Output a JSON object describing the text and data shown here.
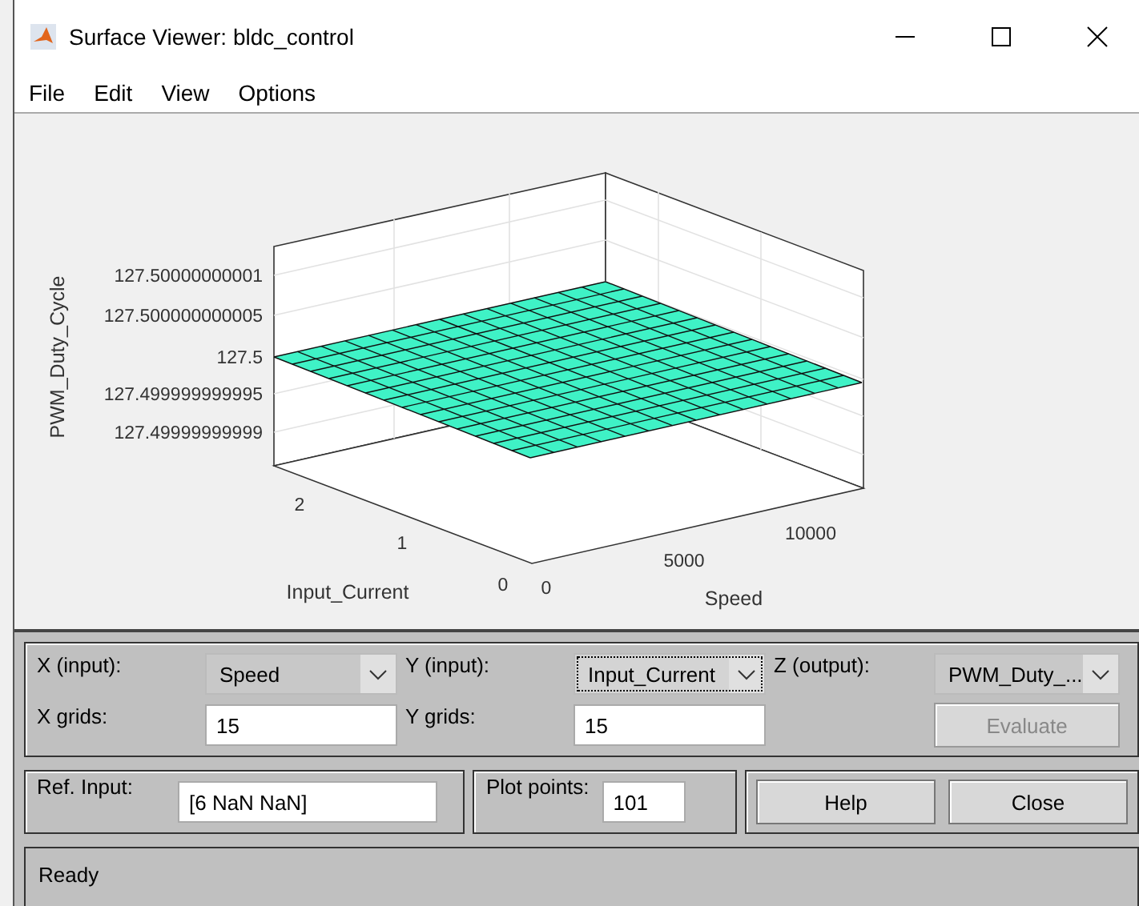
{
  "window": {
    "title": "Surface Viewer: bldc_control"
  },
  "menu": [
    "File",
    "Edit",
    "View",
    "Options"
  ],
  "plot": {
    "z_label": "PWM_Duty_Cycle",
    "z_ticks": [
      "127.50000000001",
      "127.500000000005",
      "127.5",
      "127.499999999995",
      "127.49999999999"
    ],
    "y_label": "Input_Current",
    "y_ticks": [
      "2",
      "1",
      "0"
    ],
    "x_label": "Speed",
    "x_ticks": [
      "0",
      "5000",
      "10000"
    ]
  },
  "selectors": [
    {
      "label": "X (input):",
      "value": "Speed",
      "focused": false
    },
    {
      "label": "Y (input):",
      "value": "Input_Current",
      "focused": true
    },
    {
      "label": "Z (output):",
      "value": "PWM_Duty_...",
      "focused": false
    }
  ],
  "grids": [
    {
      "label": "X grids:",
      "value": "15"
    },
    {
      "label": "Y grids:",
      "value": "15"
    }
  ],
  "evaluate": {
    "label": "Evaluate",
    "disabled": true
  },
  "ref_input": {
    "label": "Ref. Input:",
    "value": "[6 NaN NaN]"
  },
  "plot_points": {
    "label": "Plot points:",
    "value": "101"
  },
  "buttons": [
    "Help",
    "Close"
  ],
  "status": "Ready"
}
